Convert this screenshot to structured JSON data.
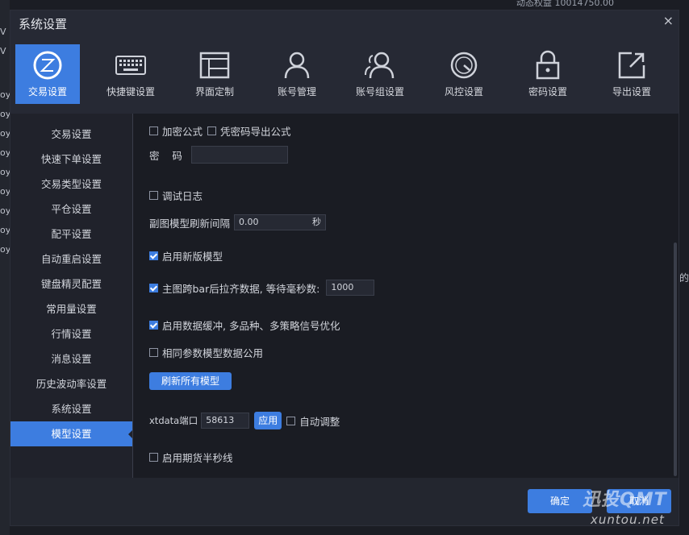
{
  "background": {
    "top_right_text": "动态权益  10014750.00",
    "left_fragments": [
      "V",
      "V",
      "oy",
      "oy",
      "oy",
      "oy",
      "oy",
      "oy",
      "oy",
      "oy",
      "oy"
    ],
    "right_fragment": "的"
  },
  "dialog": {
    "title": "系统设置",
    "close_glyph": "×"
  },
  "toolbar": [
    {
      "label": "交易设置",
      "icon": "trade-icon"
    },
    {
      "label": "快捷键设置",
      "icon": "keyboard-icon"
    },
    {
      "label": "界面定制",
      "icon": "layout-icon"
    },
    {
      "label": "账号管理",
      "icon": "user-icon"
    },
    {
      "label": "账号组设置",
      "icon": "user-group-icon"
    },
    {
      "label": "风控设置",
      "icon": "gauge-icon"
    },
    {
      "label": "密码设置",
      "icon": "lock-icon"
    },
    {
      "label": "导出设置",
      "icon": "export-icon"
    }
  ],
  "nav": [
    "交易设置",
    "快速下单设置",
    "交易类型设置",
    "平仓设置",
    "配平设置",
    "自动重启设置",
    "键盘精灵配置",
    "常用量设置",
    "行情设置",
    "消息设置",
    "历史波动率设置",
    "系统设置",
    "模型设置"
  ],
  "content": {
    "encrypt_formula": "加密公式",
    "password_export": "凭密码导出公式",
    "password_label": "密    码",
    "password_value": "",
    "debug_log": "调试日志",
    "refresh_interval_label": "副图模型刷新间隔",
    "refresh_interval_value": "0.00",
    "refresh_interval_unit": "秒",
    "enable_new_model": "启用新版模型",
    "bar_align_label": "主图跨bar后拉齐数据, 等待毫秒数:",
    "bar_align_value": "1000",
    "data_cache": "启用数据缓冲, 多品种、多策略信号优化",
    "shared_params": "相同参数模型数据公用",
    "refresh_all_button": "刷新所有模型",
    "xtdata_label": "xtdata端口",
    "xtdata_value": "58613",
    "apply_button": "应用",
    "auto_adjust": "自动调整",
    "futures_half_second": "启用期货半秒线"
  },
  "footer": {
    "ok_button": "确定",
    "cancel_button": "取消"
  },
  "watermark": {
    "line1": "迅投QMT",
    "line2": "xuntou.net"
  },
  "colors": {
    "accent": "#3d7de0",
    "panel": "#262934",
    "content": "#1a1c23"
  }
}
